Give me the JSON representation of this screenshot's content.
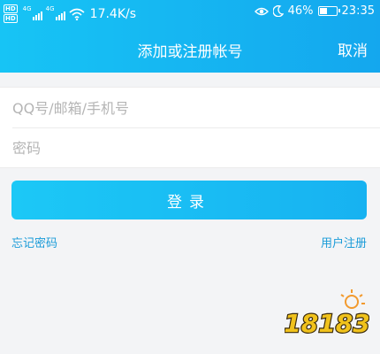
{
  "status_bar": {
    "hd1": "HD",
    "hd2": "HD",
    "signal1_tag": "4G",
    "signal2_tag": "4G",
    "net_speed": "17.4K/s",
    "battery_text": "46%",
    "battery_level": 0.46,
    "time": "23:35",
    "icons": [
      "hd-icon",
      "signal-icon",
      "wifi-icon",
      "eye-icon",
      "moon-icon",
      "battery-icon"
    ]
  },
  "nav": {
    "title": "添加或注册帐号",
    "cancel": "取消"
  },
  "form": {
    "account_placeholder": "QQ号/邮箱/手机号",
    "password_placeholder": "密码"
  },
  "login_button": "登录",
  "links": {
    "forgot_password": "忘记密码",
    "register": "用户注册"
  },
  "watermark": {
    "text": "18183"
  },
  "colors": {
    "header": "#17c4f5",
    "accent": "#17b2f1",
    "link": "#1a9bd8",
    "background": "#f3f4f6"
  }
}
